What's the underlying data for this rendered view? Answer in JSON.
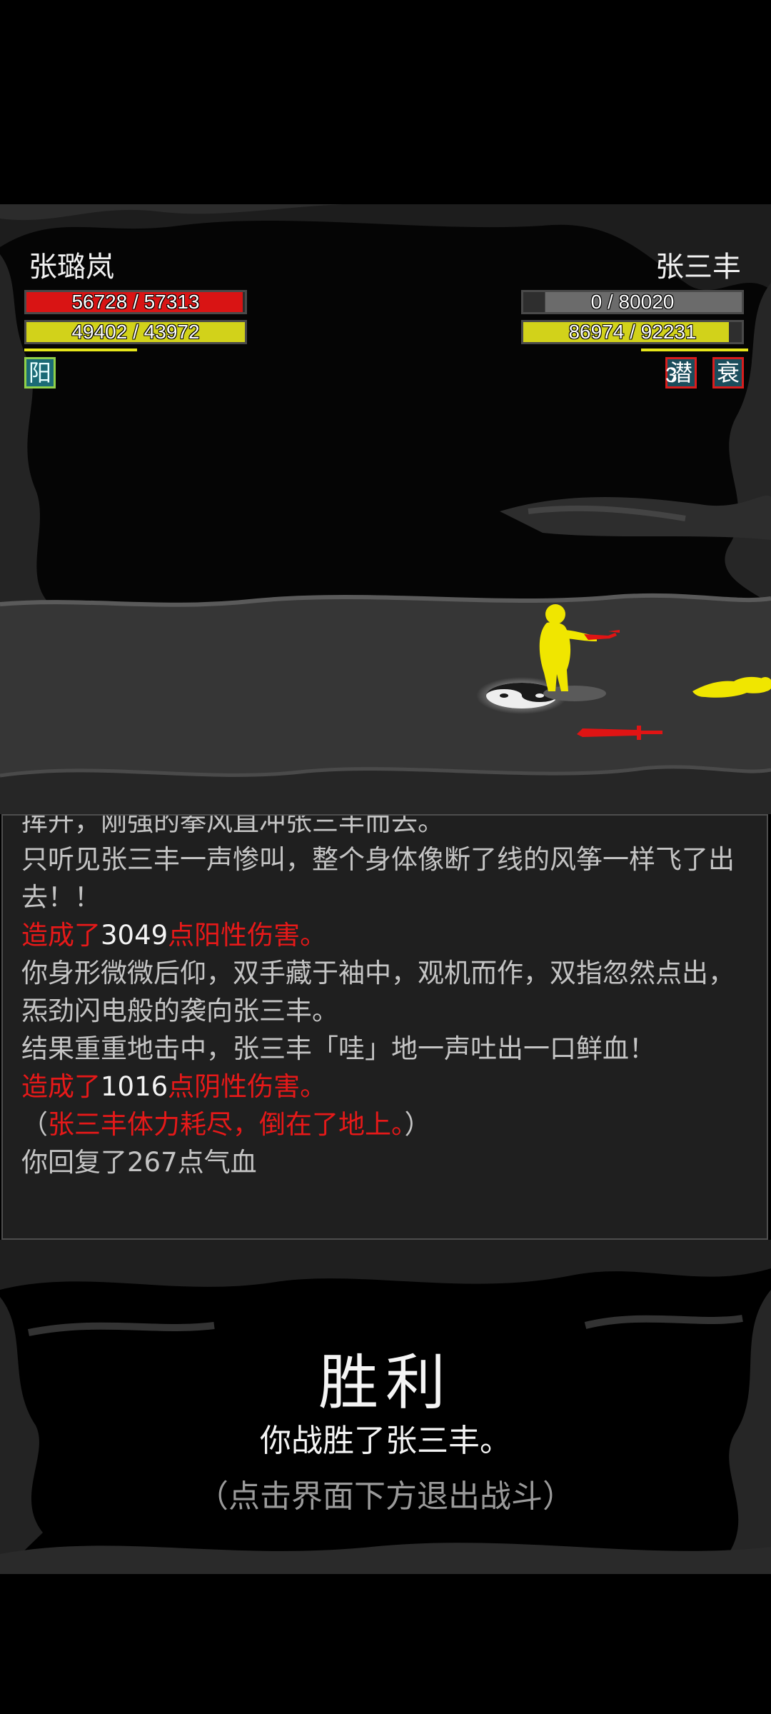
{
  "player": {
    "name": "张璐岚",
    "hp_text": "56728 / 57313",
    "hp_ratio": 0.99,
    "qi_text": "49402 / 43972",
    "qi_ratio": 1.0,
    "status_icons": [
      {
        "glyph": "阳",
        "name": "yang-status-icon"
      }
    ]
  },
  "enemy": {
    "name": "张三丰",
    "hp_text": "0 / 80020",
    "hp_ratio": 0.0,
    "qi_text": "86974 / 92231",
    "qi_ratio": 0.94,
    "status_icons": [
      {
        "glyph": "潜",
        "count": "3",
        "name": "qian-status-icon"
      },
      {
        "glyph": "衰",
        "name": "shuai-status-icon"
      }
    ]
  },
  "colors": {
    "hp_fill": "#d91414",
    "qi_fill": "#d2d21a",
    "empty_hp_fill": "#6b6b6b",
    "log_red": "#e61919",
    "log_text": "#c4c4c4"
  },
  "battle_log": [
    [
      {
        "text": "挥开，刚强的拳风直冲张三丰而去。",
        "style": "normal"
      }
    ],
    [
      {
        "text": "只听见张三丰一声惨叫，整个身体像断了线的风筝一样飞了出去！！",
        "style": "normal"
      }
    ],
    [
      {
        "text": "造成了",
        "style": "red"
      },
      {
        "text": "3049",
        "style": "white"
      },
      {
        "text": "点阳性伤害。",
        "style": "red"
      }
    ],
    [
      {
        "text": "你身形微微后仰，双手藏于袖中，观机而作，双指忽然点出，炁劲闪电般的袭向张三丰。",
        "style": "normal"
      }
    ],
    [
      {
        "text": "结果重重地击中，张三丰「哇」地一声吐出一口鲜血！",
        "style": "normal"
      }
    ],
    [
      {
        "text": "造成了",
        "style": "red"
      },
      {
        "text": "1016",
        "style": "white"
      },
      {
        "text": "点阴性伤害。",
        "style": "red"
      }
    ],
    [
      {
        "text": "（",
        "style": "normal"
      },
      {
        "text": "张三丰体力耗尽，倒在了地上。",
        "style": "red"
      },
      {
        "text": "）",
        "style": "normal"
      }
    ],
    [
      {
        "text": "你回复了267点气血",
        "style": "normal"
      }
    ]
  ],
  "result": {
    "title": "胜利",
    "text": "你战胜了张三丰。",
    "hint": "（点击界面下方退出战斗）"
  }
}
